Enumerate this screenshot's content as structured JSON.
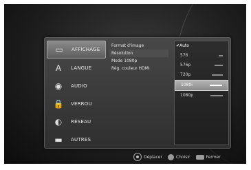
{
  "menu": [
    {
      "label": "AFFICHAGE",
      "icon": "display-icon",
      "glyph": "▭",
      "active": true
    },
    {
      "label": "LANGUE",
      "icon": "language-icon",
      "glyph": "A",
      "active": false
    },
    {
      "label": "AUDIO",
      "icon": "audio-icon",
      "glyph": "◉",
      "active": false
    },
    {
      "label": "VERROU",
      "icon": "lock-icon",
      "glyph": "🔒",
      "active": false
    },
    {
      "label": "RÉSEAU",
      "icon": "network-icon",
      "glyph": "◐",
      "active": false
    },
    {
      "label": "AUTRES",
      "icon": "others-icon",
      "glyph": "▬",
      "active": false
    }
  ],
  "submenu": [
    {
      "label": "Format d'image",
      "selected": false
    },
    {
      "label": "Résolution",
      "selected": true
    },
    {
      "label": "Mode 1080p",
      "selected": false
    },
    {
      "label": "Rég. couleur HDMI",
      "selected": false
    }
  ],
  "values": [
    {
      "label": "✔Auto"
    },
    {
      "label": "576"
    },
    {
      "label": "576p"
    },
    {
      "label": "720p"
    },
    {
      "label": "1080i",
      "highlight": true
    },
    {
      "label": "1080p"
    }
  ],
  "footer": {
    "move": "Déplacer",
    "select": "Choisir",
    "close": "Fermer"
  }
}
